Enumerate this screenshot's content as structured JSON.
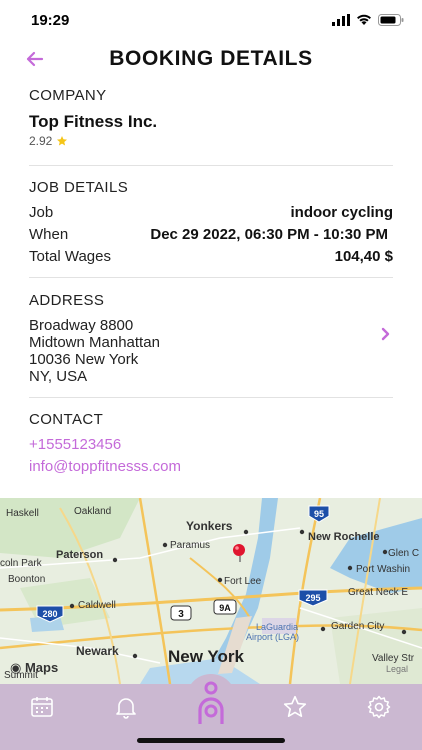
{
  "status_bar": {
    "time": "19:29"
  },
  "header": {
    "title": "BOOKING DETAILS"
  },
  "company": {
    "section_label": "COMPANY",
    "name": "Top Fitness Inc.",
    "rating": "2.92"
  },
  "job": {
    "section_label": "JOB DETAILS",
    "rows": [
      {
        "label": "Job",
        "value": "indoor cycling"
      },
      {
        "label": "When",
        "value": "Dec 29 2022, 06:30 PM - 10:30 PM"
      },
      {
        "label": "Total Wages",
        "value": "104,40 $"
      }
    ]
  },
  "address": {
    "section_label": "ADDRESS",
    "lines": [
      "Broadway 8800",
      "Midtown Manhattan",
      "10036 New York",
      "NY, USA"
    ]
  },
  "contact": {
    "section_label": "CONTACT",
    "phone": "+1555123456",
    "email": "info@toppfitnesss.com"
  },
  "map": {
    "labels": {
      "haskell": "Haskell",
      "oakland": "Oakland",
      "yonkers": "Yonkers",
      "paramus": "Paramus",
      "paterson": "Paterson",
      "new_rochelle": "New Rochelle",
      "glen_cove": "Glen C",
      "lincoln_park": "coln Park",
      "boonton": "Boonton",
      "fort_lee": "Fort Lee",
      "port_washington": "Port Washin",
      "great_neck": "Great Neck E",
      "caldwell": "Caldwell",
      "laguardia": "LaGuardia",
      "laguardia2": "Airport (LGA)",
      "garden_city": "Garden City",
      "newark": "Newark",
      "new_york": "New York",
      "valley_stream": "Valley Str",
      "summit": "Summit",
      "shield_95": "95",
      "shield_295": "295",
      "shield_280": "280",
      "shield_3": "3",
      "shield_9a": "9A",
      "maps_logo": "Maps",
      "legal": "Legal"
    }
  },
  "colors": {
    "accent": "#c46ad9",
    "tabbar": "#cbb8d1",
    "star": "#f5c518",
    "pin": "#e0152f",
    "water": "#9fcbe8"
  },
  "tabs": [
    "calendar-icon",
    "bell-icon",
    "logo-icon",
    "star-icon",
    "gear-icon"
  ]
}
